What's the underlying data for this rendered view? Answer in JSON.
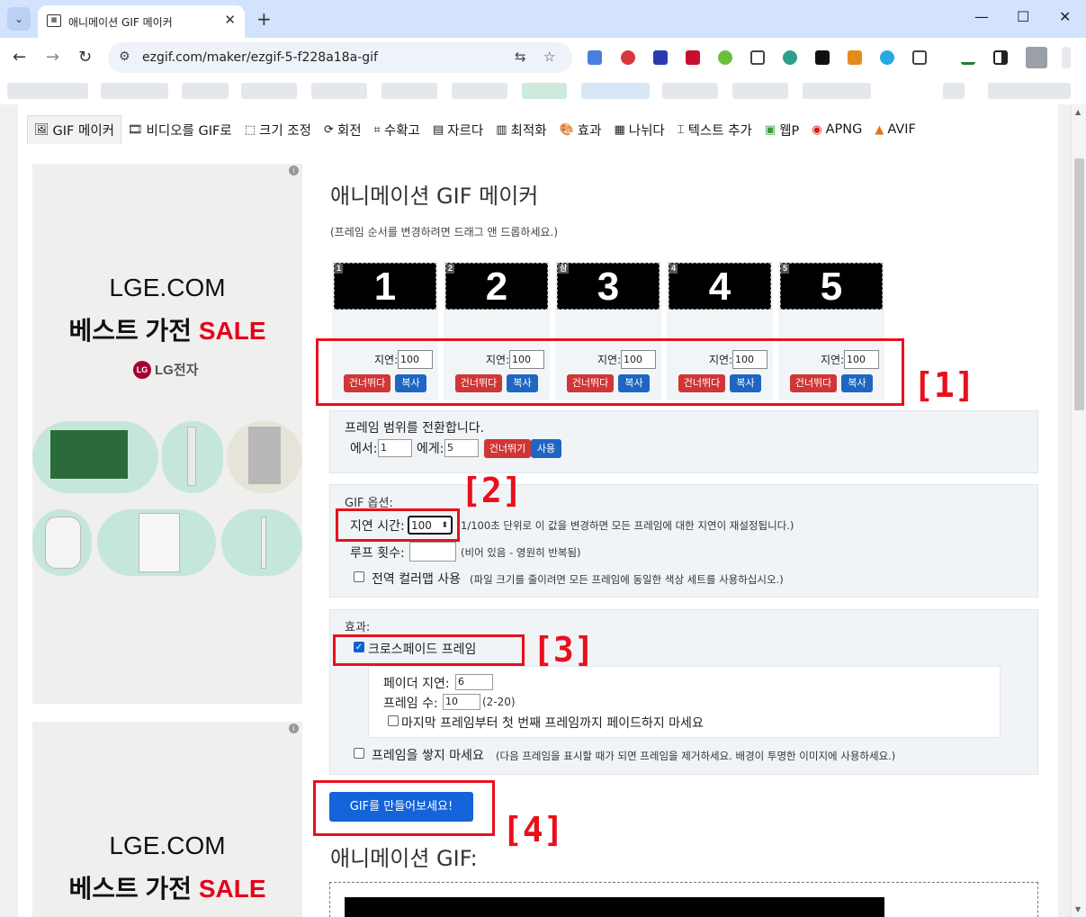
{
  "browser": {
    "tab_title": "애니메이션 GIF 메이커",
    "tab_favicon": "tab-favicon",
    "url": "ezgif.com/maker/ezgif-5-f228a18a-gif"
  },
  "tool_menu": [
    {
      "icon": "gif-icon",
      "label": "GIF 메이커"
    },
    {
      "icon": "film-icon",
      "label": "비디오를 GIF로"
    },
    {
      "icon": "resize-icon",
      "label": "크기 조정"
    },
    {
      "icon": "rotate-icon",
      "label": "회전"
    },
    {
      "icon": "crop-icon",
      "label": "수확고"
    },
    {
      "icon": "cut-icon",
      "label": "자르다"
    },
    {
      "icon": "optimize-icon",
      "label": "최적화"
    },
    {
      "icon": "palette-icon",
      "label": "효과"
    },
    {
      "icon": "split-icon",
      "label": "나뉘다"
    },
    {
      "icon": "text-icon",
      "label": "텍스트 추가"
    },
    {
      "icon": "webp-icon",
      "label": "웹P"
    },
    {
      "icon": "apng-icon",
      "label": "APNG"
    },
    {
      "icon": "avif-icon",
      "label": "AVIF"
    }
  ],
  "ad": {
    "line1": "LGE.COM",
    "line2_prefix": "베스트 가전 ",
    "line2_sale": "SALE",
    "brand": "LG전자",
    "brand_mark": "LG",
    "info": "i"
  },
  "main": {
    "title": "애니메이션 GIF 메이커",
    "hint": "(프레임 순서를 변경하려면 드래그 앤 드롭하세요.)"
  },
  "frames": [
    {
      "index": "1",
      "label": "1",
      "delay_label": "지연:",
      "delay": "100",
      "skip": "건너뛰다",
      "copy": "복사"
    },
    {
      "index": "2",
      "label": "2",
      "delay_label": "지연:",
      "delay": "100",
      "skip": "건너뛰다",
      "copy": "복사"
    },
    {
      "index": "삼",
      "label": "3",
      "delay_label": "지연:",
      "delay": "100",
      "skip": "건너뛰다",
      "copy": "복사"
    },
    {
      "index": "4",
      "label": "4",
      "delay_label": "지연:",
      "delay": "100",
      "skip": "건너뛰다",
      "copy": "복사"
    },
    {
      "index": "5",
      "label": "5",
      "delay_label": "지연:",
      "delay": "100",
      "skip": "건너뛰다",
      "copy": "복사"
    }
  ],
  "range": {
    "title": "프레임 범위를 전환합니다.",
    "from_label": "에서:",
    "from": "1",
    "to_label": "에게:",
    "to": "5",
    "skip": "건너뛰기",
    "use": "사용"
  },
  "gif_options": {
    "title": "GIF 옵션:",
    "delay_label": "지연 시간:",
    "delay": "100",
    "delay_note": "1/100초 단위로 이 값을 변경하면 모든 프레임에 대한 지연이 재설정됩니다.)",
    "loop_label": "루프 횟수:",
    "loop": "",
    "loop_note": "(비어 있음 - 영원히 반복됨)",
    "colormap_label": "전역 컬러맵 사용",
    "colormap_note": "(파일 크기를 줄이려면 모든 프레임에 동일한 색상 세트를 사용하십시오.)"
  },
  "effects": {
    "title": "효과:",
    "crossfade_label": "크로스페이드 프레임",
    "crossfade_checked": true,
    "fader_delay_label": "페이더 지연:",
    "fader_delay": "6",
    "frame_count_label": "프레임 수:",
    "frame_count": "10",
    "frame_count_note": "(2-20)",
    "no_last_fade_label": "마지막 프레임부터 첫 번째 프레임까지 페이드하지 마세요",
    "no_stack_label": "프레임을 쌓지 마세요",
    "no_stack_note": "(다음 프레임을 표시할 때가 되면 프레임을 제거하세요. 배경이 투명한 이미지에 사용하세요.)"
  },
  "make_button": "GIF를 만들어보세요!",
  "result_title": "애니메이션 GIF:",
  "annotations": [
    "[1]",
    "[2]",
    "[3]",
    "[4]"
  ],
  "colors": {
    "annotation": "#e8101c",
    "primary": "#1363d9",
    "danger": "#d03636"
  }
}
